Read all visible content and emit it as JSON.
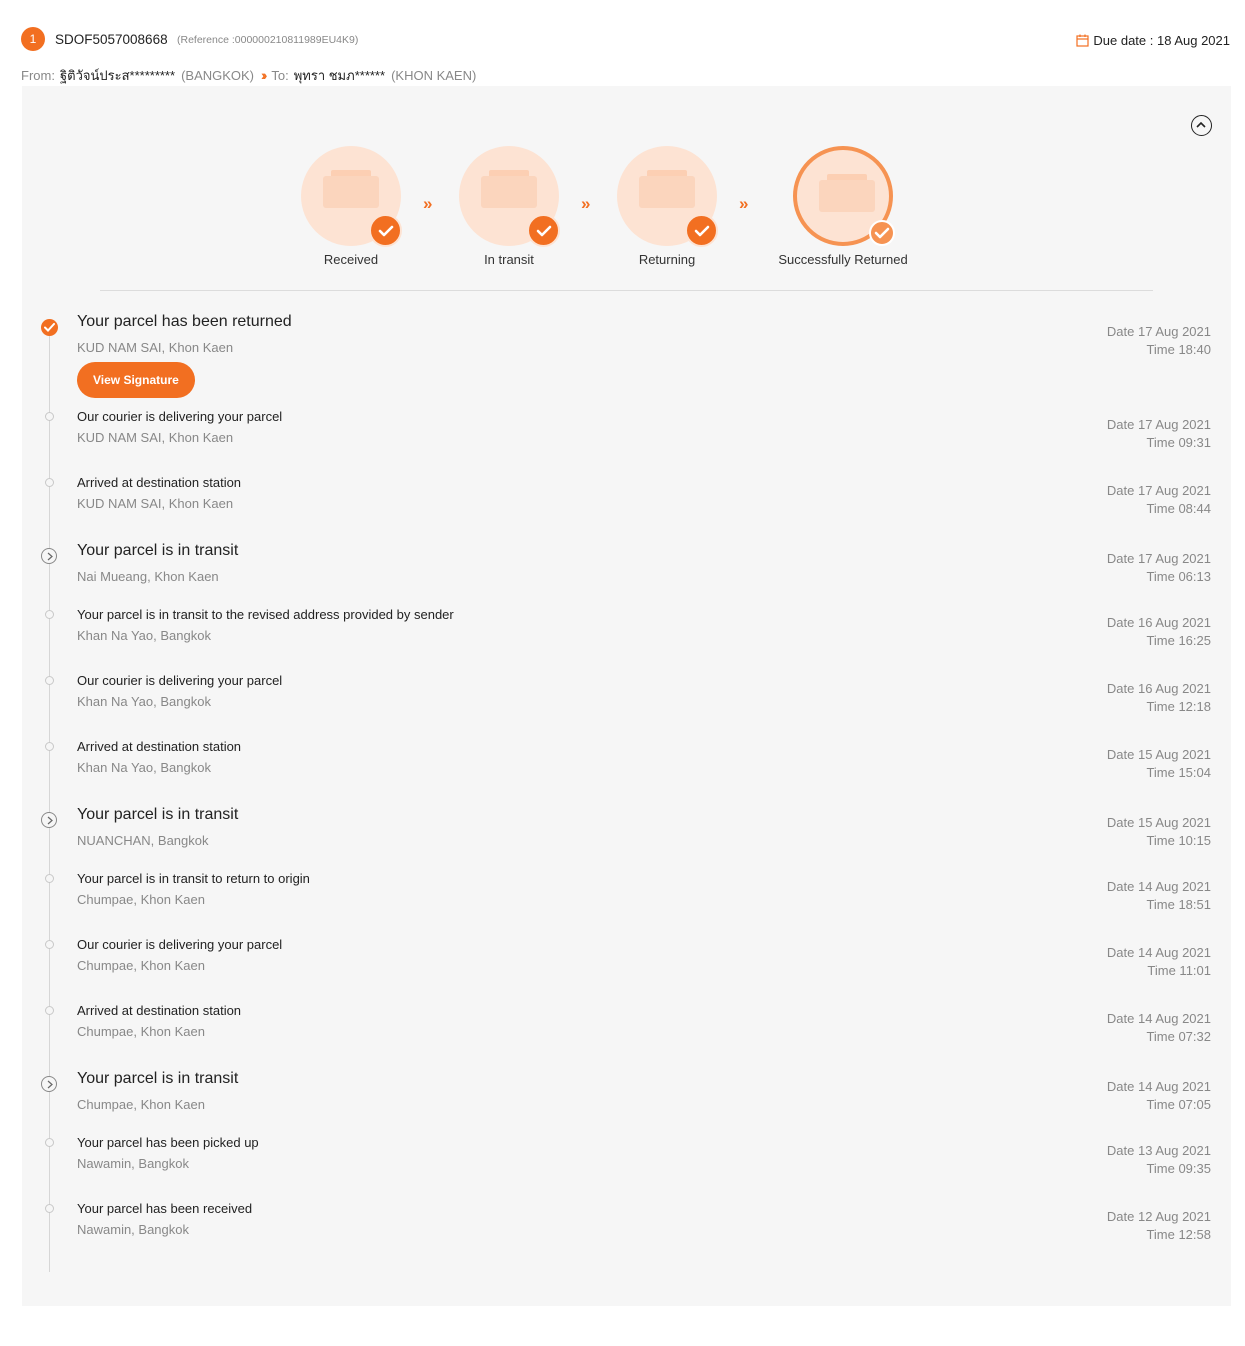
{
  "header": {
    "index": "1",
    "tracking_number": "SDOF5057008668",
    "reference": "(Reference :000000210811989EU4K9)",
    "due_date": "Due date : 18 Aug 2021",
    "from_label": "From:",
    "from_name": "ฐิติวัจน์ประส*********",
    "from_province": "(BANGKOK)",
    "to_label": "To:",
    "to_name": "พุทรา ชมภ******",
    "to_province": "(KHON KAEN)",
    "accent_color": "#f26f21"
  },
  "progress": {
    "steps": [
      {
        "label": "Received",
        "icon": "parcel-box-icon"
      },
      {
        "label": "In transit",
        "icon": "delivery-truck-icon"
      },
      {
        "label": "Returning",
        "icon": "return-parcel-icon"
      },
      {
        "label": "Successfully Returned",
        "icon": "returned-parcel-icon"
      }
    ],
    "arrow": "»"
  },
  "events": [
    {
      "title": "Your parcel has been returned",
      "location": "KUD NAM SAI, Khon Kaen",
      "date": "Date 17 Aug 2021",
      "time": "Time 18:40",
      "button": "View Signature"
    },
    {
      "title": "Our courier is delivering your parcel",
      "location": "KUD NAM SAI, Khon Kaen",
      "date": "Date 17 Aug 2021",
      "time": "Time 09:31"
    },
    {
      "title": "Arrived at destination station",
      "location": "KUD NAM SAI, Khon Kaen",
      "date": "Date 17 Aug 2021",
      "time": "Time 08:44"
    },
    {
      "title": "Your parcel is in transit",
      "location": "Nai Mueang, Khon Kaen",
      "date": "Date 17 Aug 2021",
      "time": "Time 06:13"
    },
    {
      "title": "Your parcel is in transit to the revised address provided by sender",
      "location": "Khan Na Yao, Bangkok",
      "date": "Date 16 Aug 2021",
      "time": "Time 16:25"
    },
    {
      "title": "Our courier is delivering your parcel",
      "location": "Khan Na Yao, Bangkok",
      "date": "Date 16 Aug 2021",
      "time": "Time 12:18"
    },
    {
      "title": "Arrived at destination station",
      "location": "Khan Na Yao, Bangkok",
      "date": "Date 15 Aug 2021",
      "time": "Time 15:04"
    },
    {
      "title": "Your parcel is in transit",
      "location": "NUANCHAN, Bangkok",
      "date": "Date 15 Aug 2021",
      "time": "Time 10:15"
    },
    {
      "title": "Your parcel is in transit to return to origin",
      "location": "Chumpae, Khon Kaen",
      "date": "Date 14 Aug 2021",
      "time": "Time 18:51"
    },
    {
      "title": "Our courier is delivering your parcel",
      "location": "Chumpae, Khon Kaen",
      "date": "Date 14 Aug 2021",
      "time": "Time 11:01"
    },
    {
      "title": "Arrived at destination station",
      "location": "Chumpae, Khon Kaen",
      "date": "Date 14 Aug 2021",
      "time": "Time 07:32"
    },
    {
      "title": "Your parcel is in transit",
      "location": "Chumpae, Khon Kaen",
      "date": "Date 14 Aug 2021",
      "time": "Time 07:05"
    },
    {
      "title": "Your parcel has been picked up",
      "location": "Nawamin, Bangkok",
      "date": "Date 13 Aug 2021",
      "time": "Time 09:35"
    },
    {
      "title": "Your parcel has been received",
      "location": "Nawamin, Bangkok",
      "date": "Date 12 Aug 2021",
      "time": "Time 12:58"
    }
  ]
}
